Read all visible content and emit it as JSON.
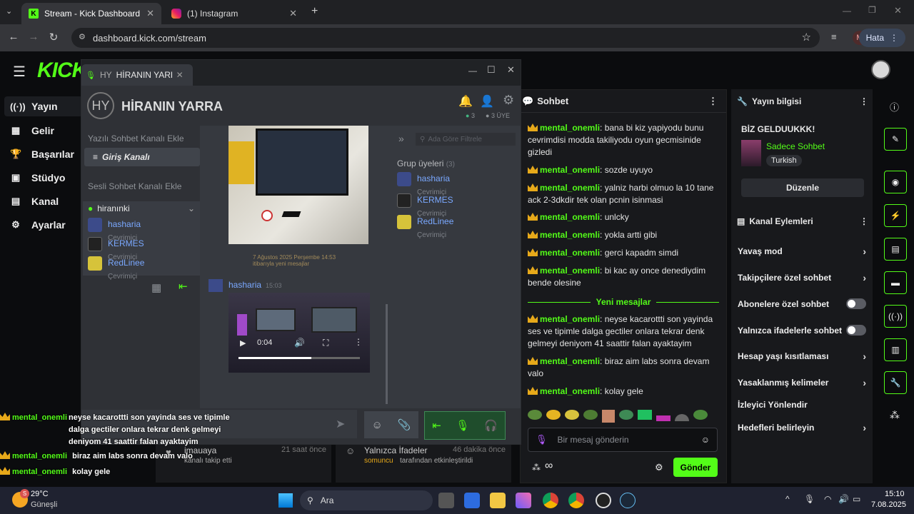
{
  "browser": {
    "tabs": [
      {
        "title": "Stream - Kick Dashboard",
        "icon": "kick-icon"
      },
      {
        "title": "(1) Instagram",
        "icon": "instagram-icon"
      }
    ],
    "url": "dashboard.kick.com/stream",
    "profile_initial": "M",
    "error_label": "Hata"
  },
  "kick": {
    "logo": "KICK",
    "sidebar": [
      {
        "label": "Yayın",
        "icon": "broadcast-icon"
      },
      {
        "label": "Gelir",
        "icon": "chart-icon"
      },
      {
        "label": "Başarılar",
        "icon": "trophy-icon"
      },
      {
        "label": "Stüdyo",
        "icon": "studio-icon"
      },
      {
        "label": "Kanal",
        "icon": "channel-icon"
      },
      {
        "label": "Ayarlar",
        "icon": "gear-icon"
      }
    ]
  },
  "discord": {
    "tab_initials": "HY",
    "tab_title": "HİRANIN YARRA",
    "server_name": "HİRANIN YARRA",
    "online_count": "3",
    "member_count": "3 ÜYE",
    "text_channel_add": "Yazılı Sohbet Kanalı Ekle",
    "channel": "Giriş Kanalı",
    "voice_channel_add": "Sesli Sohbet Kanalı Ekle",
    "voice_channel": "hiranınki",
    "voice_users": [
      {
        "name": "hasharia",
        "status": "Çevrimiçi"
      },
      {
        "name": "KERMES",
        "status": "Çevrimiçi"
      },
      {
        "name": "RedLinee",
        "status": "Çevrimiçi"
      }
    ],
    "date_divider": "7 Ağustos 2025 Perşembe 14:53",
    "new_messages_note": "itibarıyla yeni mesajlar",
    "message_author": "hasharia",
    "message_time": "15:03",
    "video_time": "0:04",
    "filter_placeholder": "Ada Göre Filtrele",
    "group_members_label": "Grup üyeleri",
    "group_members_count": "(3)",
    "members": [
      {
        "name": "hasharia",
        "status": "Çevrimiçi"
      },
      {
        "name": "KERMES",
        "status": "Çevrimiçi"
      },
      {
        "name": "RedLinee",
        "status": "Çevrimiçi"
      }
    ]
  },
  "chat": {
    "title": "Sohbet",
    "messages_before": [
      {
        "user": "mental_onemli",
        "text": "bana bi kiz yapiyodu bunu cevrimdisi modda takiliyodu oyun gecmisinide gizledi"
      },
      {
        "user": "mental_onemli",
        "text": "sozde uyuyo"
      },
      {
        "user": "mental_onemli",
        "text": "yalniz harbi olmuo la 10 tane ack 2-3dkdir tek olan pcnin isinmasi"
      },
      {
        "user": "mental_onemli",
        "text": "unlcky"
      },
      {
        "user": "mental_onemli",
        "text": "yokla artti gibi"
      },
      {
        "user": "mental_onemli",
        "text": "gerci kapadm simdi"
      },
      {
        "user": "mental_onemli",
        "text": "bi kac ay once denediydim bende olesine"
      }
    ],
    "new_messages_divider": "Yeni mesajlar",
    "messages_after": [
      {
        "user": "mental_onemli",
        "text": "neyse kacarottti son yayinda ses ve tipimle dalga gectiler onlara tekrar denk gelmeyi deniyom 41 saattir falan ayaktayim"
      },
      {
        "user": "mental_onemli",
        "text": "biraz aim labs sonra devam valo"
      },
      {
        "user": "mental_onemli",
        "text": "kolay gele"
      }
    ],
    "input_placeholder": "Bir mesaj gönderin",
    "send_label": "Gönder",
    "points": "∞"
  },
  "stream_info": {
    "title": "Yayın bilgisi",
    "stream_title": "BİZ GELDUUKKK!",
    "category": "Sadece Sohbet",
    "language": "Turkish",
    "edit_label": "Düzenle"
  },
  "channel_actions": {
    "title": "Kanal Eylemleri",
    "items": [
      {
        "label": "Yavaş mod",
        "control": "chevron"
      },
      {
        "label": "Takipçilere özel sohbet",
        "control": "chevron"
      },
      {
        "label": "Abonelere özel sohbet",
        "control": "toggle",
        "enabled": false
      },
      {
        "label": "Yalnızca ifadelerle sohbet",
        "control": "toggle",
        "enabled": false
      },
      {
        "label": "Hesap yaşı kısıtlaması",
        "control": "chevron"
      },
      {
        "label": "Yasaklanmış kelimeler",
        "control": "chevron"
      },
      {
        "label": "İzleyici Yönlendir",
        "control": "none"
      },
      {
        "label": "Hedefleri belirleyin",
        "control": "chevron"
      }
    ]
  },
  "activity": {
    "left_user": "imauaya",
    "left_action": "kanalı takip etti",
    "left_time": "21 saat önce",
    "right_title": "Yalnızca İfadeler",
    "right_time": "46 dakika önce",
    "right_actor": "somuncu",
    "right_action": "tarafından etkinleştirildi"
  },
  "overlay": [
    {
      "user": "mental_onemli",
      "text": "neyse kacarottti son yayinda ses ve tipimle dalga gectiler onlara tekrar denk gelmeyi deniyom 41 saattir falan ayaktayim"
    },
    {
      "user": "mental_onemli",
      "text": "biraz aim labs sonra devam valo"
    },
    {
      "user": "mental_onemli",
      "text": "kolay gele"
    }
  ],
  "taskbar": {
    "weather_temp": "29°C",
    "weather_desc": "Güneşli",
    "weather_badge": "S",
    "search_label": "Ara",
    "time": "15:10",
    "date": "7.08.2025"
  }
}
